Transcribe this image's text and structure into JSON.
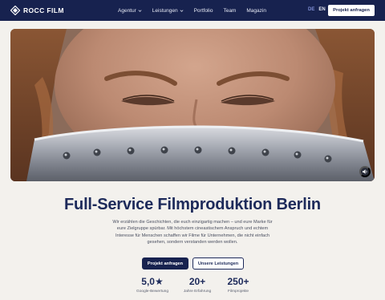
{
  "brand": {
    "name": "ROCC FILM",
    "logo_icon": "diamond-logo-icon"
  },
  "nav": {
    "items": [
      {
        "label": "Agentur",
        "has_dropdown": true
      },
      {
        "label": "Leistungen",
        "has_dropdown": true
      },
      {
        "label": "Portfolio",
        "has_dropdown": false
      },
      {
        "label": "Team",
        "has_dropdown": false
      },
      {
        "label": "Magazin",
        "has_dropdown": false
      }
    ],
    "languages": {
      "active": "DE",
      "other": "EN"
    },
    "cta_label": "Projekt anfragen"
  },
  "hero": {
    "image_alt": "",
    "sound_icon": "sound-icon"
  },
  "content": {
    "headline": "Full-Service Filmproduktion Berlin",
    "intro_lines": [
      "Wir erzählen die Geschichten, die euch einzigartig machen – und eure Marke für",
      "eure Zielgruppe spürbar. Mit höchstem cineastischem Anspruch und echtem",
      "Interesse für Menschen schaffen wir Filme für Unternehmen, die nicht einfach",
      "gesehen, sondern verstanden werden wollen."
    ],
    "primary_button": "Projekt anfragen",
    "secondary_button": "Unsere Leistungen"
  },
  "stats": [
    {
      "value": "5,0★",
      "label": "Google-Bewertung"
    },
    {
      "value": "20+",
      "label": "Jahre Erfahrung"
    },
    {
      "value": "250+",
      "label": "Filmprojekte"
    }
  ],
  "colors": {
    "navy": "#17224f",
    "heading": "#1d2a5a",
    "background": "#f3f1ed",
    "active_lang": "#7f8fd4"
  }
}
